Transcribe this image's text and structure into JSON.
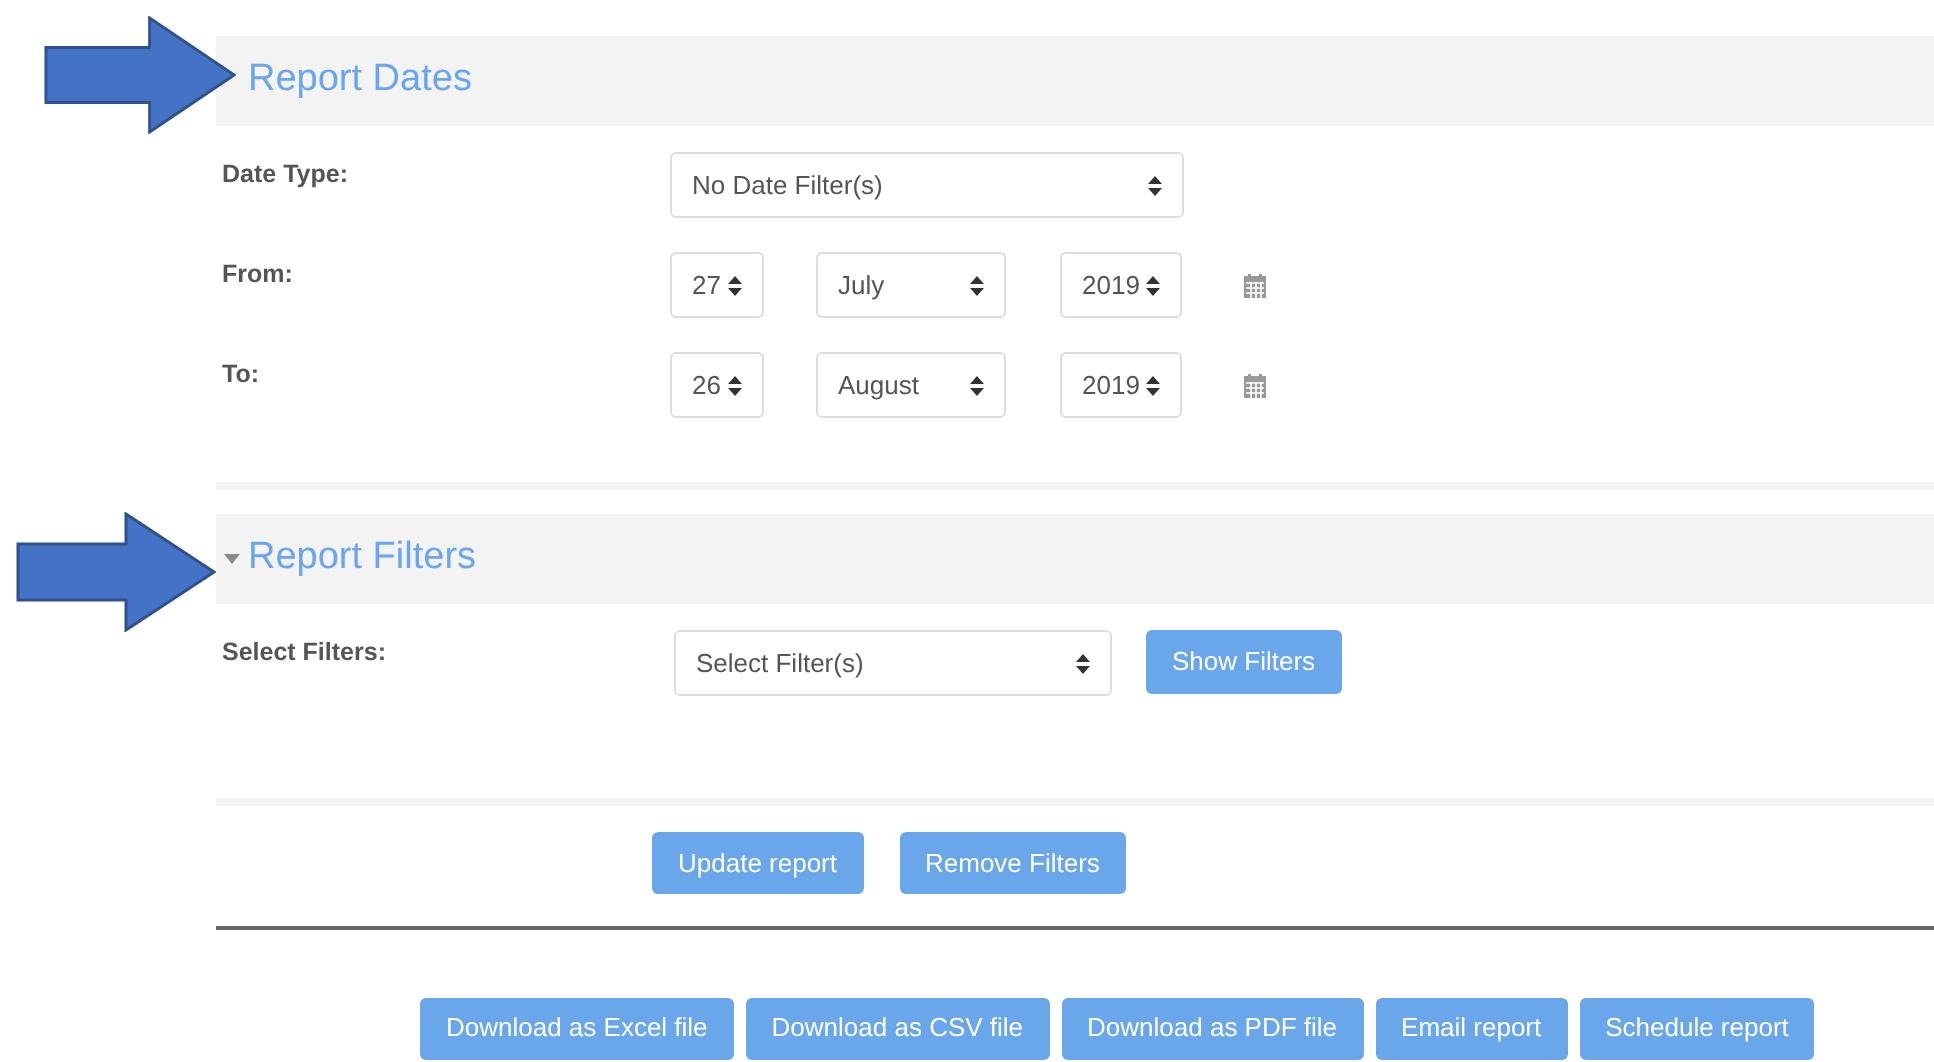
{
  "sections": [
    {
      "title": "Report Dates",
      "caret_visible": false
    },
    {
      "title": "Report Filters",
      "caret_visible": true
    }
  ],
  "date_type": {
    "label": "Date Type:",
    "value": "No Date Filter(s)"
  },
  "date_rows": [
    {
      "label": "From:",
      "day": "27",
      "month": "July",
      "year": "2019"
    },
    {
      "label": "To:",
      "day": "26",
      "month": "August",
      "year": "2019"
    }
  ],
  "filters": {
    "label": "Select Filters:",
    "value": "Select Filter(s)",
    "button": "Show Filters"
  },
  "actions": [
    "Update report",
    "Remove Filters"
  ],
  "downloads": [
    "Download as Excel file",
    "Download as CSV file",
    "Download as PDF file",
    "Email report",
    "Schedule report"
  ]
}
